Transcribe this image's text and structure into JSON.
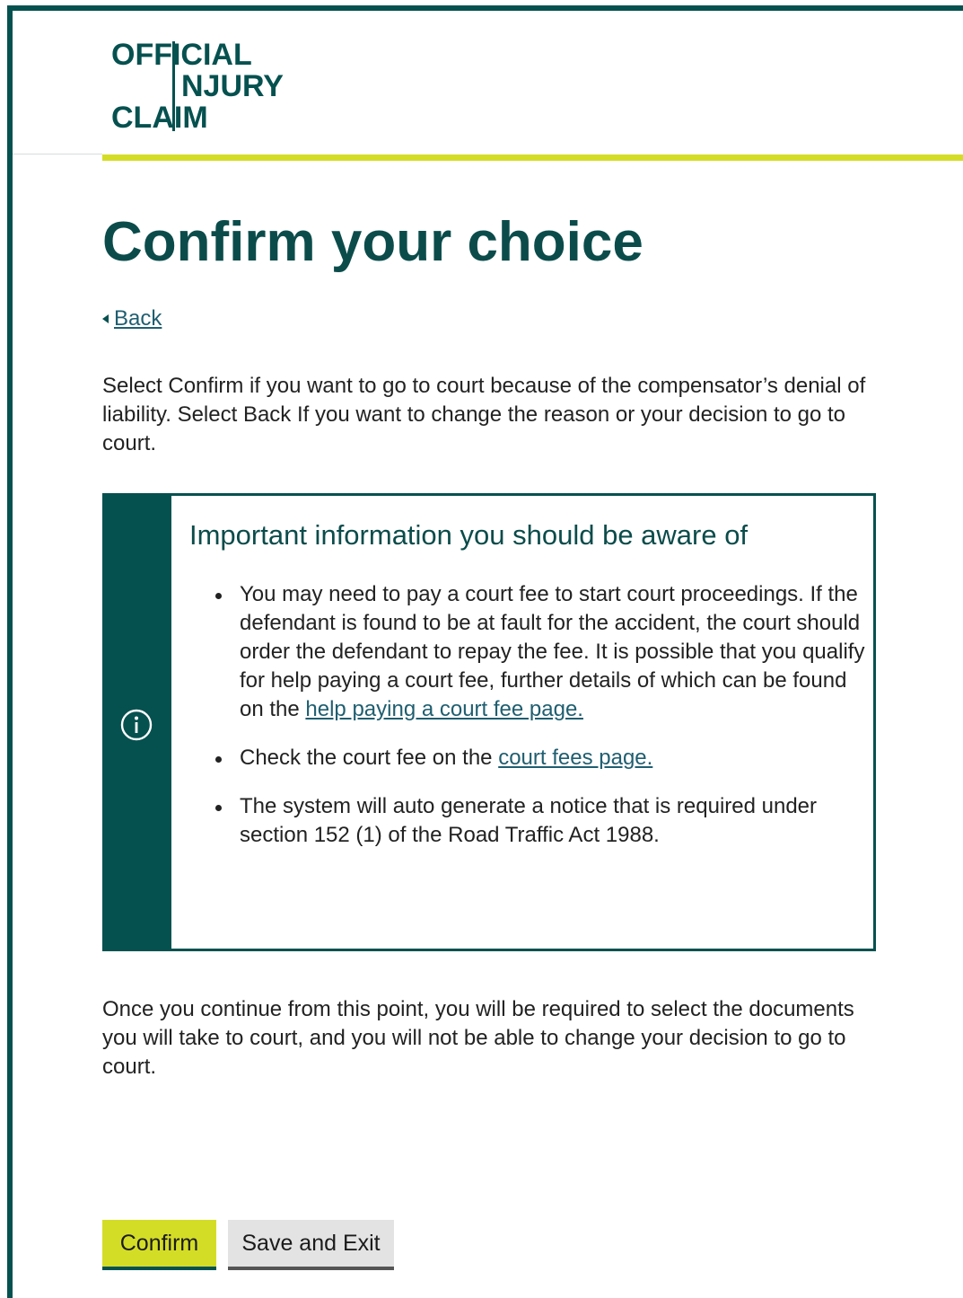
{
  "brand": {
    "logo_line1": "OFFICIAL",
    "logo_line2": "NJURY",
    "logo_line3": "CLAIM",
    "primary_color": "#055150",
    "accent_color": "#d4dd26"
  },
  "page": {
    "title": "Confirm your choice",
    "back_label": "Back",
    "intro": "Select Confirm if you want to go to court because of the compensator’s denial of liability. Select Back If you want to change the reason or your decision to go to court.",
    "outro": "Once you continue from this point, you will be required to select the documents you will take to court, and you will not be able to change your decision to go to court."
  },
  "info_panel": {
    "icon": "info-icon",
    "heading": "Important information you should be aware of",
    "item1_text": "You may need to pay a court fee to start court proceedings. If the defendant is found to be at fault for the accident, the court should order the defendant to repay the fee. It is possible that you qualify for help paying a court fee, further details of which can be found on the",
    "item1_link": "help paying a court fee page.",
    "item2_text": "Check the court fee on the",
    "item2_link": "court fees page.",
    "item3_text": "The system will auto generate a notice that is required under section 152 (1) of the Road Traffic Act 1988."
  },
  "actions": {
    "confirm_label": "Confirm",
    "save_exit_label": "Save and Exit"
  }
}
